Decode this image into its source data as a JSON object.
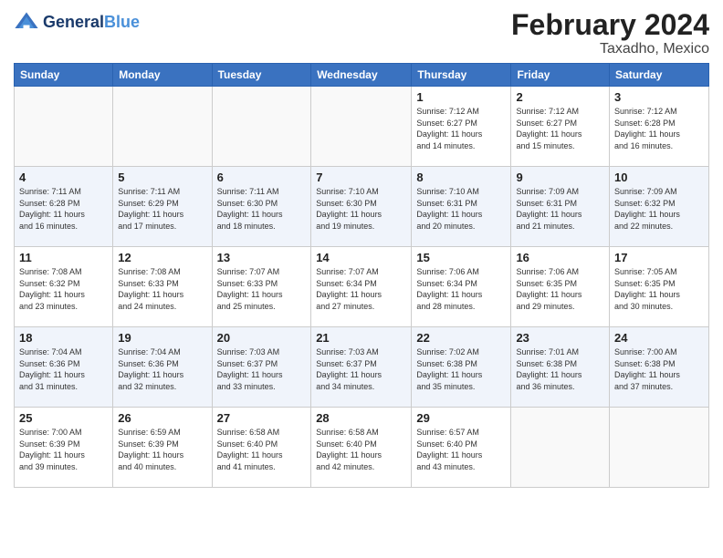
{
  "header": {
    "logo_general": "General",
    "logo_blue": "Blue",
    "title": "February 2024",
    "subtitle": "Taxadho, Mexico"
  },
  "days_of_week": [
    "Sunday",
    "Monday",
    "Tuesday",
    "Wednesday",
    "Thursday",
    "Friday",
    "Saturday"
  ],
  "weeks": [
    [
      {
        "day": "",
        "info": ""
      },
      {
        "day": "",
        "info": ""
      },
      {
        "day": "",
        "info": ""
      },
      {
        "day": "",
        "info": ""
      },
      {
        "day": "1",
        "info": "Sunrise: 7:12 AM\nSunset: 6:27 PM\nDaylight: 11 hours\nand 14 minutes."
      },
      {
        "day": "2",
        "info": "Sunrise: 7:12 AM\nSunset: 6:27 PM\nDaylight: 11 hours\nand 15 minutes."
      },
      {
        "day": "3",
        "info": "Sunrise: 7:12 AM\nSunset: 6:28 PM\nDaylight: 11 hours\nand 16 minutes."
      }
    ],
    [
      {
        "day": "4",
        "info": "Sunrise: 7:11 AM\nSunset: 6:28 PM\nDaylight: 11 hours\nand 16 minutes."
      },
      {
        "day": "5",
        "info": "Sunrise: 7:11 AM\nSunset: 6:29 PM\nDaylight: 11 hours\nand 17 minutes."
      },
      {
        "day": "6",
        "info": "Sunrise: 7:11 AM\nSunset: 6:30 PM\nDaylight: 11 hours\nand 18 minutes."
      },
      {
        "day": "7",
        "info": "Sunrise: 7:10 AM\nSunset: 6:30 PM\nDaylight: 11 hours\nand 19 minutes."
      },
      {
        "day": "8",
        "info": "Sunrise: 7:10 AM\nSunset: 6:31 PM\nDaylight: 11 hours\nand 20 minutes."
      },
      {
        "day": "9",
        "info": "Sunrise: 7:09 AM\nSunset: 6:31 PM\nDaylight: 11 hours\nand 21 minutes."
      },
      {
        "day": "10",
        "info": "Sunrise: 7:09 AM\nSunset: 6:32 PM\nDaylight: 11 hours\nand 22 minutes."
      }
    ],
    [
      {
        "day": "11",
        "info": "Sunrise: 7:08 AM\nSunset: 6:32 PM\nDaylight: 11 hours\nand 23 minutes."
      },
      {
        "day": "12",
        "info": "Sunrise: 7:08 AM\nSunset: 6:33 PM\nDaylight: 11 hours\nand 24 minutes."
      },
      {
        "day": "13",
        "info": "Sunrise: 7:07 AM\nSunset: 6:33 PM\nDaylight: 11 hours\nand 25 minutes."
      },
      {
        "day": "14",
        "info": "Sunrise: 7:07 AM\nSunset: 6:34 PM\nDaylight: 11 hours\nand 27 minutes."
      },
      {
        "day": "15",
        "info": "Sunrise: 7:06 AM\nSunset: 6:34 PM\nDaylight: 11 hours\nand 28 minutes."
      },
      {
        "day": "16",
        "info": "Sunrise: 7:06 AM\nSunset: 6:35 PM\nDaylight: 11 hours\nand 29 minutes."
      },
      {
        "day": "17",
        "info": "Sunrise: 7:05 AM\nSunset: 6:35 PM\nDaylight: 11 hours\nand 30 minutes."
      }
    ],
    [
      {
        "day": "18",
        "info": "Sunrise: 7:04 AM\nSunset: 6:36 PM\nDaylight: 11 hours\nand 31 minutes."
      },
      {
        "day": "19",
        "info": "Sunrise: 7:04 AM\nSunset: 6:36 PM\nDaylight: 11 hours\nand 32 minutes."
      },
      {
        "day": "20",
        "info": "Sunrise: 7:03 AM\nSunset: 6:37 PM\nDaylight: 11 hours\nand 33 minutes."
      },
      {
        "day": "21",
        "info": "Sunrise: 7:03 AM\nSunset: 6:37 PM\nDaylight: 11 hours\nand 34 minutes."
      },
      {
        "day": "22",
        "info": "Sunrise: 7:02 AM\nSunset: 6:38 PM\nDaylight: 11 hours\nand 35 minutes."
      },
      {
        "day": "23",
        "info": "Sunrise: 7:01 AM\nSunset: 6:38 PM\nDaylight: 11 hours\nand 36 minutes."
      },
      {
        "day": "24",
        "info": "Sunrise: 7:00 AM\nSunset: 6:38 PM\nDaylight: 11 hours\nand 37 minutes."
      }
    ],
    [
      {
        "day": "25",
        "info": "Sunrise: 7:00 AM\nSunset: 6:39 PM\nDaylight: 11 hours\nand 39 minutes."
      },
      {
        "day": "26",
        "info": "Sunrise: 6:59 AM\nSunset: 6:39 PM\nDaylight: 11 hours\nand 40 minutes."
      },
      {
        "day": "27",
        "info": "Sunrise: 6:58 AM\nSunset: 6:40 PM\nDaylight: 11 hours\nand 41 minutes."
      },
      {
        "day": "28",
        "info": "Sunrise: 6:58 AM\nSunset: 6:40 PM\nDaylight: 11 hours\nand 42 minutes."
      },
      {
        "day": "29",
        "info": "Sunrise: 6:57 AM\nSunset: 6:40 PM\nDaylight: 11 hours\nand 43 minutes."
      },
      {
        "day": "",
        "info": ""
      },
      {
        "day": "",
        "info": ""
      }
    ]
  ]
}
